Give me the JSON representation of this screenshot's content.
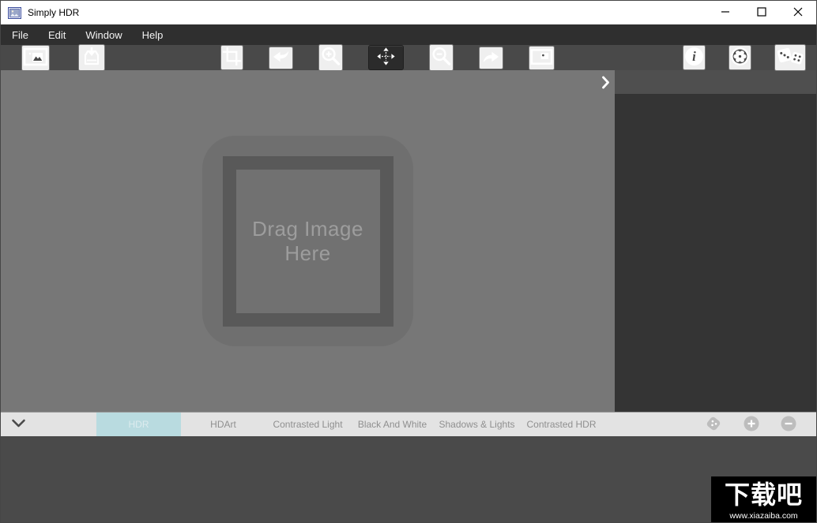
{
  "window": {
    "title": "Simply HDR"
  },
  "titlebar": {
    "control_icons": [
      "minimize-icon",
      "maximize-icon",
      "close-icon"
    ]
  },
  "menubar": {
    "items": [
      "File",
      "Edit",
      "Window",
      "Help"
    ]
  },
  "toolbar": {
    "icons_left": [
      "open-image-icon",
      "import-image-icon"
    ],
    "icons_center": [
      "crop-icon",
      "undo-icon",
      "zoom-in-icon",
      "move-icon",
      "zoom-out-icon",
      "redo-icon",
      "image-adjust-icon"
    ],
    "selected_tool": "move-tool",
    "icons_right": [
      "info-icon",
      "settings-icon",
      "dice-icon"
    ]
  },
  "canvas": {
    "dropzone_text": "Drag Image Here",
    "panel_toggle_icon": "chevron-right-icon"
  },
  "tabbar": {
    "collapse_icon": "chevron-down-icon",
    "tabs": [
      {
        "label": "HDR",
        "active": true
      },
      {
        "label": "HDArt",
        "active": false
      },
      {
        "label": "Contrasted Light",
        "active": false
      },
      {
        "label": "Black And White",
        "active": false
      },
      {
        "label": "Shadows & Lights",
        "active": false
      },
      {
        "label": "Contrasted HDR",
        "active": false
      }
    ],
    "action_icons": [
      "randomize-preset-icon",
      "add-preset-icon",
      "remove-preset-icon"
    ]
  },
  "watermark": {
    "logo": "下载吧",
    "url": "www.xiazaiba.com"
  },
  "colors": {
    "titlebar_bg": "#ffffff",
    "menubar_bg": "#2f2f2f",
    "toolbar_bg": "#494949",
    "canvas_bg": "#777777",
    "panel_bg": "#343434",
    "panel_band_bg": "#4f4f4f",
    "tabbar_bg": "#e3e3e3",
    "active_tab_bg": "#b9dbe0",
    "active_tab_text": "#dcebee",
    "tab_text": "#8f8f8f",
    "bottom_bg": "#4a4a4a",
    "watermark_bg": "#000000"
  }
}
